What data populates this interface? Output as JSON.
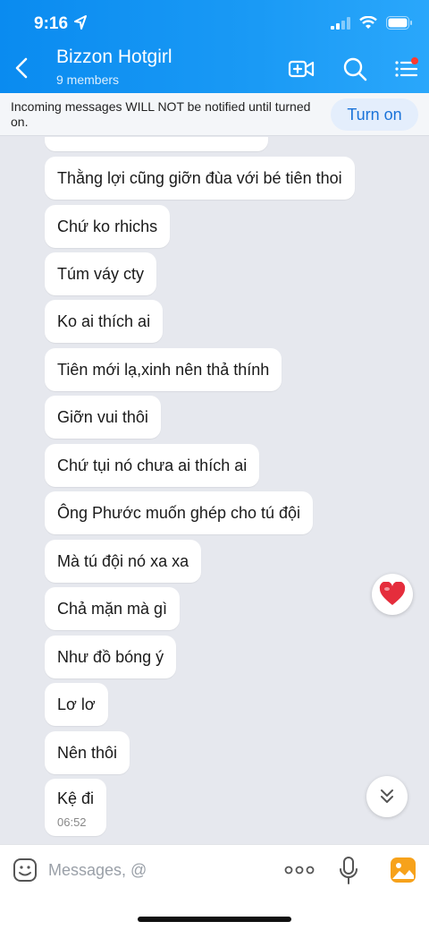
{
  "status_bar": {
    "time": "9:16"
  },
  "header": {
    "title": "Bizzon Hotgirl",
    "subtitle": "9 members"
  },
  "notice": {
    "text": "Incoming messages WILL NOT be notified until turned on.",
    "button": "Turn on"
  },
  "messages": [
    {
      "text": "Thằng lợi cũng giỡn đùa với bé tiên thoi"
    },
    {
      "text": "Chứ ko rhichs"
    },
    {
      "text": "Túm váy cty"
    },
    {
      "text": "Ko ai thích ai"
    },
    {
      "text": "Tiên mới lạ,xinh nên thả thính"
    },
    {
      "text": "Giỡn vui thôi"
    },
    {
      "text": "Chứ tụi nó chưa ai thích ai"
    },
    {
      "text": "Ông Phước muốn ghép cho tú đội"
    },
    {
      "text": "Mà tú đội nó xa xa"
    },
    {
      "text": "Chả mặn mà gì"
    },
    {
      "text": "Như đồ bóng ý"
    },
    {
      "text": "Lơ lơ"
    },
    {
      "text": "Nên thôi"
    },
    {
      "text": "Kệ đi",
      "time": "06:52"
    }
  ],
  "composer": {
    "placeholder": "Messages, @"
  },
  "colors": {
    "header": "#0a8bf0",
    "accent": "#1a73d9",
    "heart": "#e52d3c",
    "badge": "#ff3b30"
  },
  "icons": [
    "location-arrow-icon",
    "back-icon",
    "video-call-icon",
    "search-icon",
    "menu-icon",
    "heart-icon",
    "double-chevron-down-icon",
    "emoji-icon",
    "more-icon",
    "mic-icon",
    "gallery-icon"
  ]
}
